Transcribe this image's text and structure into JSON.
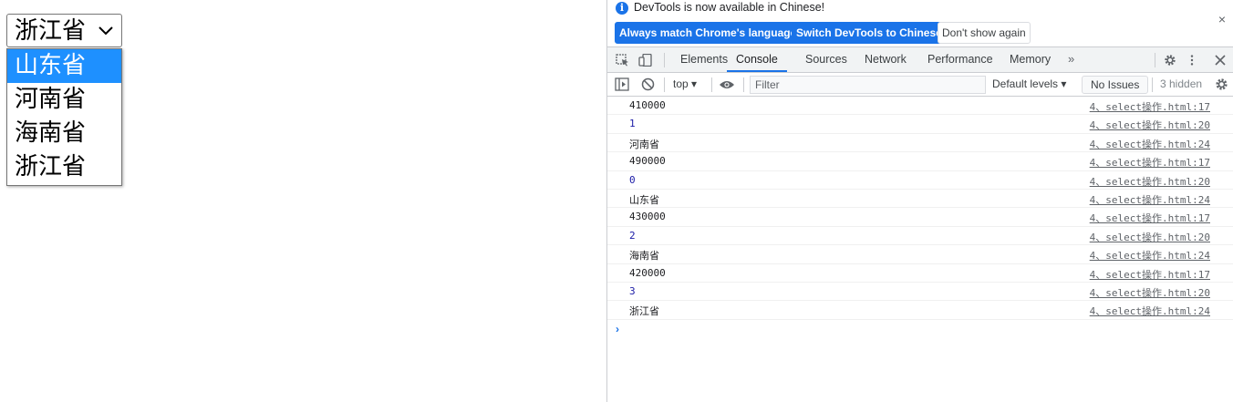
{
  "page": {
    "select": {
      "current": "浙江省",
      "options": [
        {
          "label": "山东省",
          "highlighted": true
        },
        {
          "label": "河南省",
          "highlighted": false
        },
        {
          "label": "海南省",
          "highlighted": false
        },
        {
          "label": "浙江省",
          "highlighted": false
        }
      ]
    }
  },
  "devtools": {
    "infobar": {
      "message": "DevTools is now available in Chinese!",
      "buttons": [
        "Always match Chrome's language",
        "Switch DevTools to Chinese",
        "Don't show again"
      ],
      "close": "×"
    },
    "tabs": [
      "Elements",
      "Console",
      "Sources",
      "Network",
      "Performance",
      "Memory"
    ],
    "active_tab": "Console",
    "more_tabs": "»",
    "toolbar": {
      "context": "top",
      "filter_placeholder": "Filter",
      "levels": "Default levels",
      "issues": "No Issues",
      "hidden": "3 hidden"
    },
    "console_rows": [
      {
        "value": "410000",
        "source": "4、select操作.html:17",
        "type": "string"
      },
      {
        "value": "1",
        "source": "4、select操作.html:20",
        "type": "number"
      },
      {
        "value": "河南省",
        "source": "4、select操作.html:24",
        "type": "string"
      },
      {
        "value": "490000",
        "source": "4、select操作.html:17",
        "type": "string"
      },
      {
        "value": "0",
        "source": "4、select操作.html:20",
        "type": "number"
      },
      {
        "value": "山东省",
        "source": "4、select操作.html:24",
        "type": "string"
      },
      {
        "value": "430000",
        "source": "4、select操作.html:17",
        "type": "string"
      },
      {
        "value": "2",
        "source": "4、select操作.html:20",
        "type": "number"
      },
      {
        "value": "海南省",
        "source": "4、select操作.html:24",
        "type": "string"
      },
      {
        "value": "420000",
        "source": "4、select操作.html:17",
        "type": "string"
      },
      {
        "value": "3",
        "source": "4、select操作.html:20",
        "type": "number"
      },
      {
        "value": "浙江省",
        "source": "4、select操作.html:24",
        "type": "string"
      }
    ],
    "prompt": "›",
    "colors": {
      "accent": "#1a73e8",
      "highlight": "#1e90ff",
      "number": "#1a1aa6"
    }
  }
}
